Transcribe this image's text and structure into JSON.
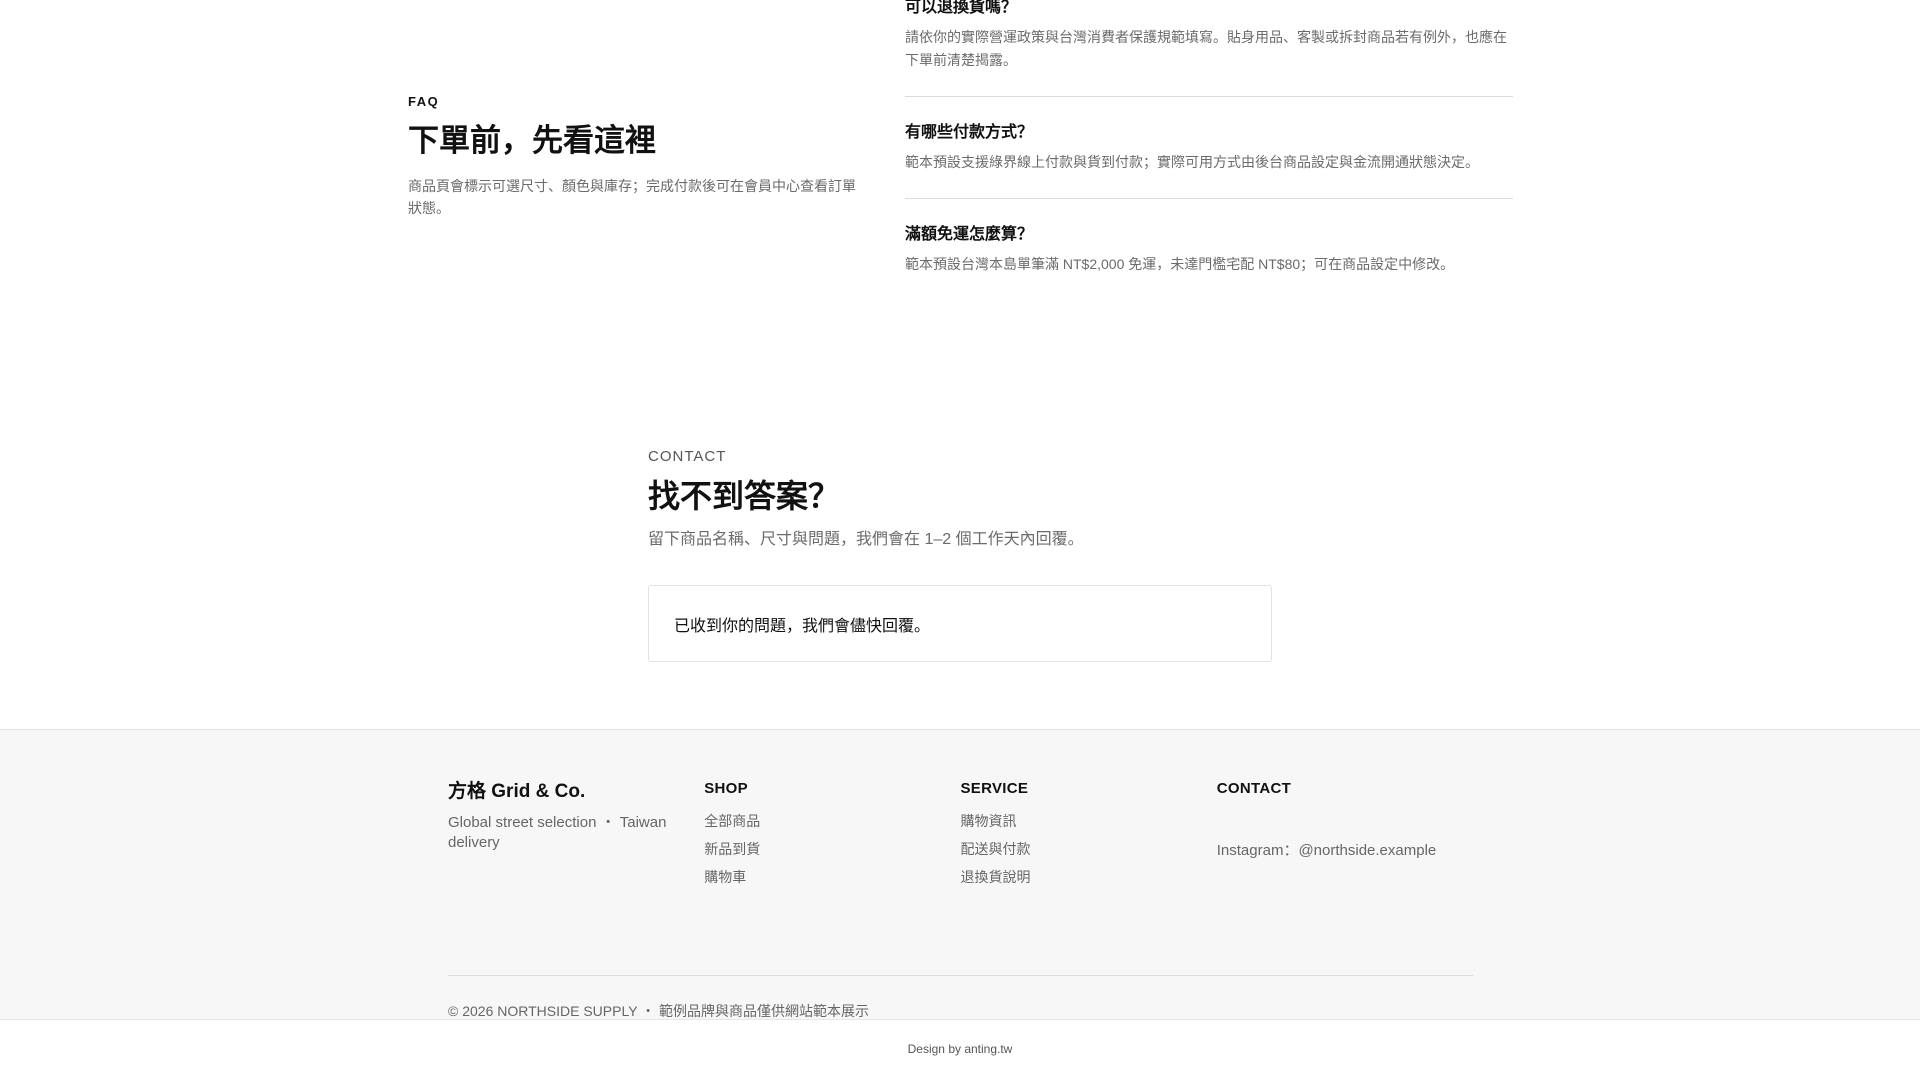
{
  "faq": {
    "eyebrow": "FAQ",
    "title": "下單前，先看這裡",
    "description": "商品頁會標示可選尺寸、顏色與庫存；完成付款後可在會員中心查看訂單狀態。",
    "items": [
      {
        "question": "可以退換貨嗎？",
        "answer": "請依你的實際營運政策與台灣消費者保護規範填寫。貼身用品、客製或拆封商品若有例外，也應在下單前清楚揭露。"
      },
      {
        "question": "有哪些付款方式？",
        "answer": "範本預設支援綠界線上付款與貨到付款；實際可用方式由後台商品設定與金流開通狀態決定。"
      },
      {
        "question": "滿額免運怎麼算？",
        "answer": "範本預設台灣本島單筆滿 NT$2,000 免運，未達門檻宅配 NT$80；可在商品設定中修改。"
      }
    ]
  },
  "contact": {
    "eyebrow": "CONTACT",
    "title": "找不到答案？",
    "description": "留下商品名稱、尺寸與問題，我們會在 1–2 個工作天內回覆。",
    "status_message": "已收到你的問題，我們會儘快回覆。"
  },
  "footer": {
    "brand_name": "方格 Grid & Co.",
    "brand_tagline": "Global street selection ・ Taiwan delivery",
    "shop": {
      "title": "SHOP",
      "links": [
        "全部商品",
        "新品到貨",
        "購物車"
      ]
    },
    "service": {
      "title": "SERVICE",
      "links": [
        "購物資訊",
        "配送與付款",
        "退換貨說明"
      ]
    },
    "contact": {
      "title": "CONTACT",
      "instagram": "Instagram：@northside.example"
    },
    "copyright": "© 2026 NORTHSIDE SUPPLY ・ 範例品牌與商品僅供網站範本展示"
  },
  "credit": "Design by anting.tw"
}
